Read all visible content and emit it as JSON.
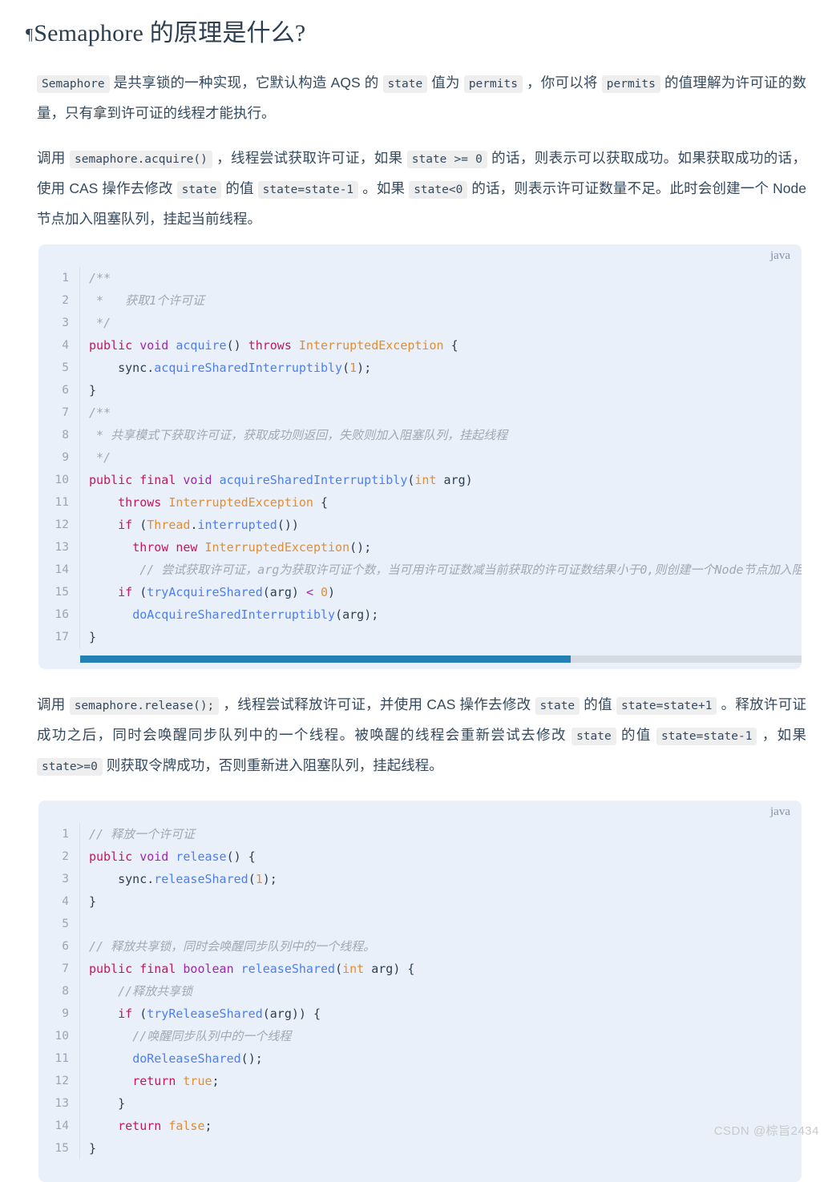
{
  "heading": {
    "anchor": "¶",
    "text": "Semaphore 的原理是什么?"
  },
  "paragraphs": {
    "p1": {
      "chip1": "Semaphore",
      "seg1": " 是共享锁的一种实现，它默认构造 AQS 的 ",
      "chip2": "state",
      "seg2": " 值为 ",
      "chip3": "permits",
      "seg3": " ，你可以将 ",
      "chip4": "permits",
      "seg4": " 的值理解为许可证的数量，只有拿到许可证的线程才能执行。"
    },
    "p2": {
      "seg1": "调用 ",
      "chip1": "semaphore.acquire()",
      "seg2": " ，线程尝试获取许可证，如果 ",
      "chip2": "state >= 0",
      "seg3": " 的话，则表示可以获取成功。如果获取成功的话，使用 CAS 操作去修改 ",
      "chip3": "state",
      "seg4": " 的值 ",
      "chip4": "state=state-1",
      "seg5": " 。如果 ",
      "chip5": "state<0",
      "seg6": " 的话，则表示许可证数量不足。此时会创建一个 Node 节点加入阻塞队列，挂起当前线程。"
    },
    "p3": {
      "seg1": "调用 ",
      "chip1": "semaphore.release();",
      "seg2": " ，线程尝试释放许可证，并使用 CAS 操作去修改 ",
      "chip2": "state",
      "seg3": " 的值 ",
      "chip3": "state=state+1",
      "seg4": " 。释放许可证成功之后，同时会唤醒同步队列中的一个线程。被唤醒的线程会重新尝试去修改 ",
      "chip4": "state",
      "seg5": " 的值 ",
      "chip5": "state=state-1",
      "seg6": " ，如果 ",
      "chip6": "state>=0",
      "seg7": " 则获取令牌成功，否则重新进入阻塞队列，挂起线程。"
    }
  },
  "code_blocks": [
    {
      "lang": "java",
      "line_numbers": [
        "1",
        "2",
        "3",
        "4",
        "5",
        "6",
        "7",
        "8",
        "9",
        "10",
        "11",
        "12",
        "13",
        "14",
        "15",
        "16",
        "17"
      ],
      "lines": [
        "/**",
        " *   获取1个许可证",
        " */",
        "public void acquire() throws InterruptedException {",
        "    sync.acquireSharedInterruptibly(1);",
        "}",
        "/**",
        " * 共享模式下获取许可证，获取成功则返回，失败则加入阻塞队列，挂起线程",
        " */",
        "public final void acquireSharedInterruptibly(int arg)",
        "    throws InterruptedException {",
        "    if (Thread.interrupted())",
        "      throw new InterruptedException();",
        "       // 尝试获取许可证，arg为获取许可证个数，当可用许可证数减当前获取的许可证数结果小于0,则创建一个Node节点加入阻塞队列",
        "    if (tryAcquireShared(arg) < 0)",
        "      doAcquireSharedInterruptibly(arg);",
        "}"
      ],
      "has_scrollbar": true,
      "scroll_thumb_percent": 68
    },
    {
      "lang": "java",
      "line_numbers": [
        "1",
        "2",
        "3",
        "4",
        "5",
        "6",
        "7",
        "8",
        "9",
        "10",
        "11",
        "12",
        "13",
        "14",
        "15"
      ],
      "lines": [
        "// 释放一个许可证",
        "public void release() {",
        "    sync.releaseShared(1);",
        "}",
        "",
        "// 释放共享锁，同时会唤醒同步队列中的一个线程。",
        "public final boolean releaseShared(int arg) {",
        "    //释放共享锁",
        "    if (tryReleaseShared(arg)) {",
        "      //唤醒同步队列中的一个线程",
        "      doReleaseShared();",
        "      return true;",
        "    }",
        "    return false;",
        "}"
      ],
      "has_scrollbar": false
    }
  ],
  "watermark": "CSDN @棕旨2434",
  "colors": {
    "heading": "#2c3e50",
    "body_text": "#34495e",
    "code_bg": "#eaf0f9",
    "chip_bg": "#eeeeee",
    "scrollbar_thumb": "#2380b5",
    "scrollbar_track": "#d4dbe3",
    "keyword": "#c2185b",
    "keyword_alt": "#9c27b0",
    "type": "#e08e35",
    "function": "#4c7ef3",
    "comment": "#a0a8b4",
    "watermark": "#c9c9c9"
  }
}
